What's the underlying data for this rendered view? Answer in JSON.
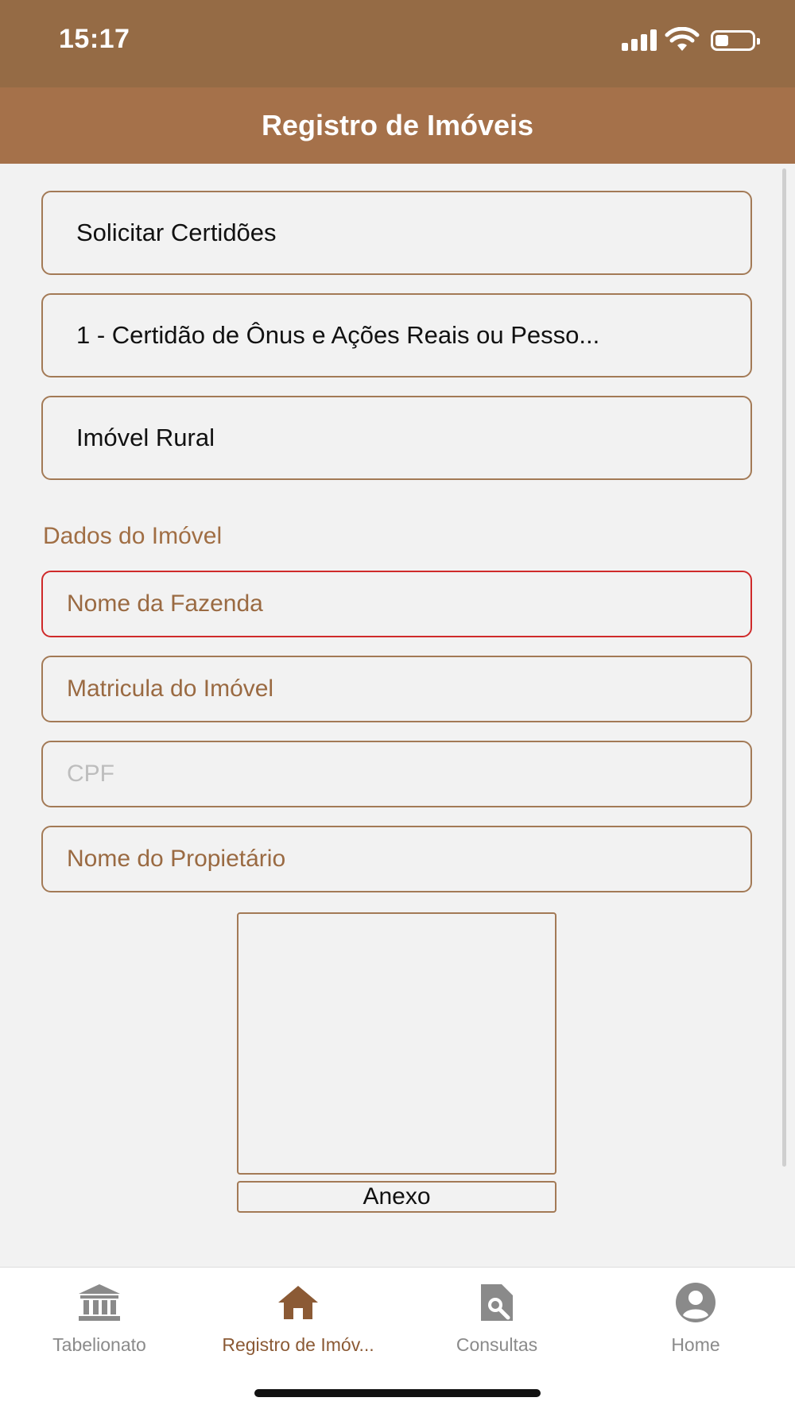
{
  "status_bar": {
    "time": "15:17",
    "icons": [
      "cellular-signal-icon",
      "wifi-icon",
      "battery-icon"
    ]
  },
  "header": {
    "title": "Registro de Imóveis"
  },
  "selectors": {
    "service": "Solicitar Certidões",
    "certificate_type": "1 - Certidão de Ônus e Ações Reais ou Pesso...",
    "property_type": "Imóvel Rural"
  },
  "form": {
    "section_label": "Dados do Imóvel",
    "farm_name": {
      "placeholder": "Nome da Fazenda"
    },
    "registration": {
      "placeholder": "Matricula do Imóvel"
    },
    "cpf": {
      "placeholder": "CPF"
    },
    "owner_name": {
      "placeholder": "Nome do Propietário"
    }
  },
  "attachment": {
    "button_label": "Anexo"
  },
  "tab_bar": {
    "items": [
      {
        "label": "Tabelionato",
        "icon": "bank-icon",
        "active": false
      },
      {
        "label": "Registro de Imóv...",
        "icon": "home-icon",
        "active": true
      },
      {
        "label": "Consultas",
        "icon": "document-search-icon",
        "active": false
      },
      {
        "label": "Home",
        "icon": "user-profile-icon",
        "active": false
      }
    ]
  },
  "colors": {
    "status_bar": "#956b45",
    "header": "#a5714a",
    "accent_border": "#a37a56",
    "error_border": "#cf2a2a",
    "input_text": "#9a6a42",
    "active_tab": "#8b5a35",
    "inactive_tab": "#8a8a8a"
  }
}
